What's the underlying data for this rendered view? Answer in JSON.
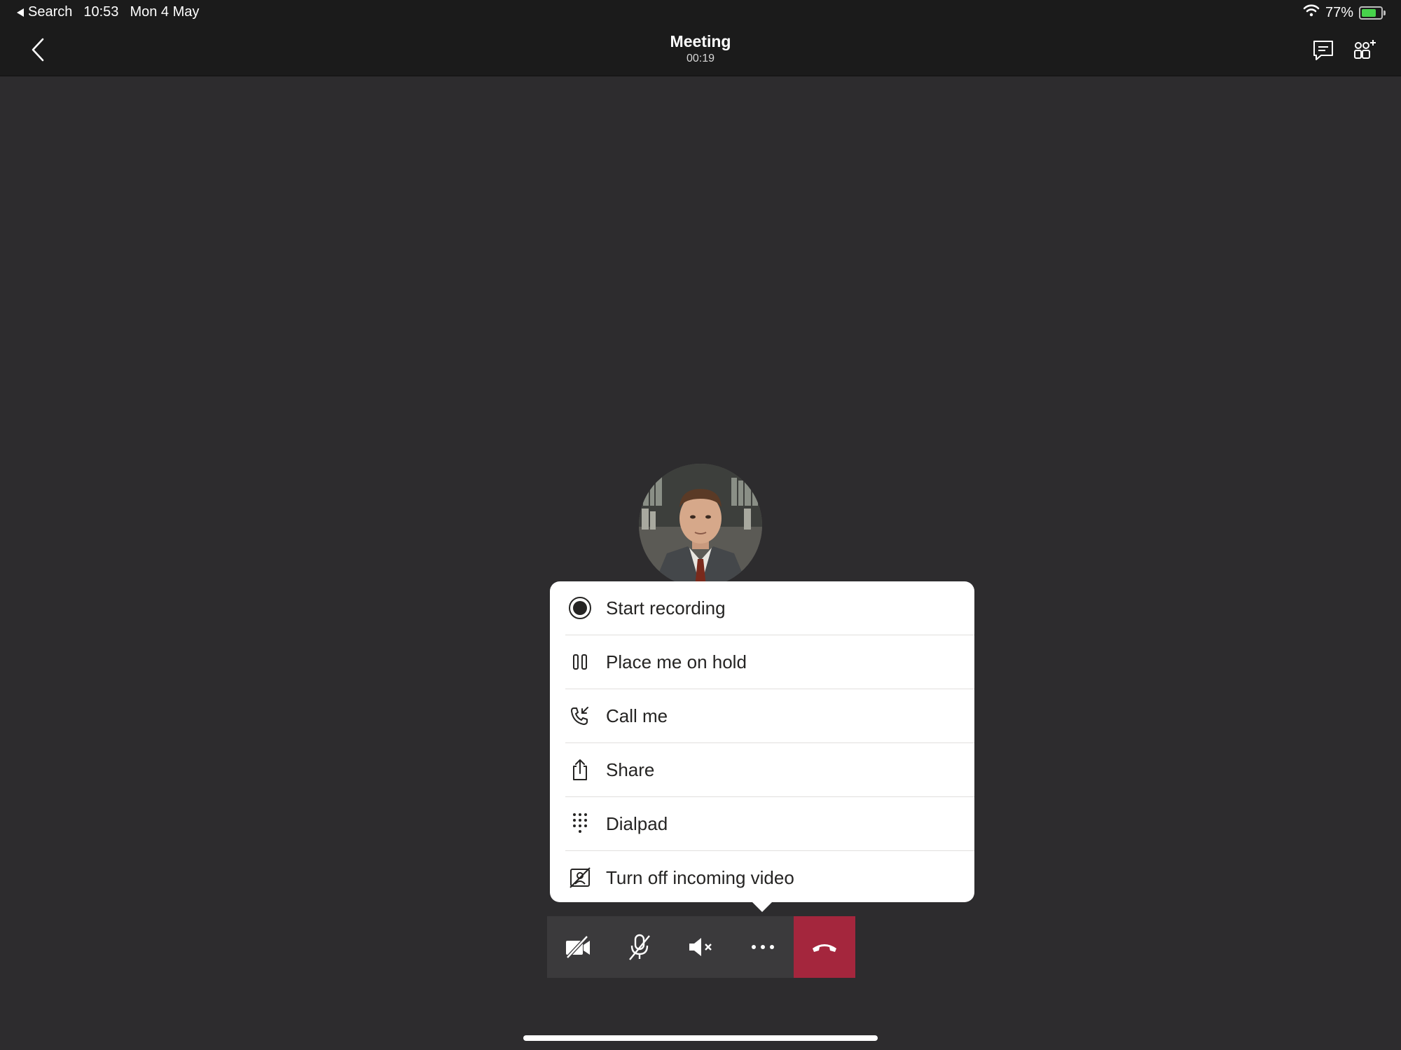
{
  "status_bar": {
    "back_app": "Search",
    "time": "10:53",
    "date": "Mon 4 May",
    "battery": "77%"
  },
  "header": {
    "title": "Meeting",
    "timer": "00:19"
  },
  "menu": {
    "items": [
      {
        "label": "Start recording",
        "icon": "record-icon"
      },
      {
        "label": "Place me on hold",
        "icon": "hold-icon"
      },
      {
        "label": "Call me",
        "icon": "call-me-icon"
      },
      {
        "label": "Share",
        "icon": "share-icon"
      },
      {
        "label": "Dialpad",
        "icon": "dialpad-icon"
      },
      {
        "label": "Turn off incoming video",
        "icon": "video-off-icon"
      }
    ]
  },
  "controls": [
    {
      "icon": "camera-off-icon"
    },
    {
      "icon": "mic-off-icon"
    },
    {
      "icon": "speaker-muted-icon"
    },
    {
      "icon": "more-icon"
    },
    {
      "icon": "hang-up-icon"
    }
  ],
  "colors": {
    "background": "#2d2c2e",
    "header": "#1b1b1b",
    "hangup": "#a4263d",
    "battery": "#47d34b"
  }
}
